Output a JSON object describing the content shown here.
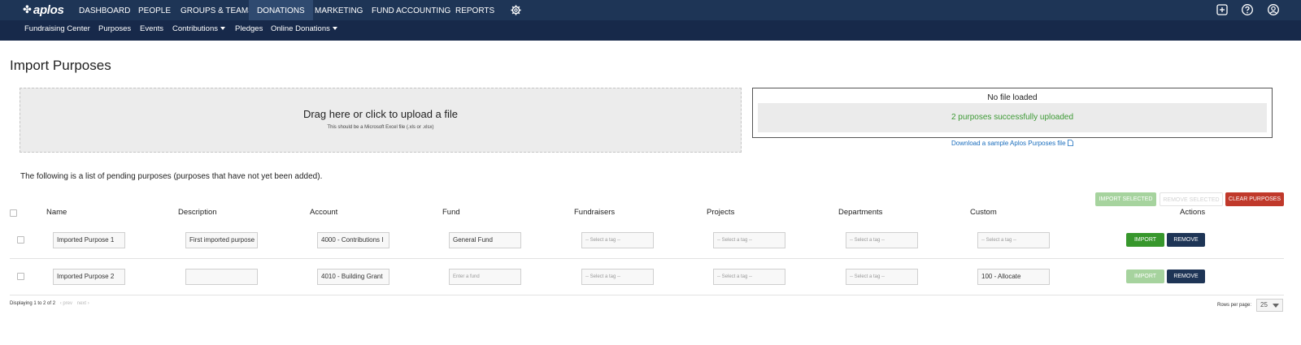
{
  "app": {
    "logo_text": "aplos"
  },
  "topnav": {
    "items": [
      "DASHBOARD",
      "PEOPLE",
      "GROUPS & TEAMS",
      "DONATIONS",
      "MARKETING",
      "FUND ACCOUNTING",
      "REPORTS"
    ],
    "active": "DONATIONS"
  },
  "subnav": {
    "items": [
      "Fundraising Center",
      "Purposes",
      "Events",
      "Contributions",
      "Pledges",
      "Online Donations"
    ]
  },
  "page": {
    "title": "Import Purposes"
  },
  "upload": {
    "title": "Drag here or click to upload a file",
    "subtitle": "This should be a Microsoft Excel file (.xls or .xlsx)"
  },
  "status": {
    "title": "No file loaded",
    "message": "2 purposes successfully uploaded",
    "message_color": "#3d9a35"
  },
  "sample_link": "Download a sample Aplos Purposes file",
  "pending_text": "The following is a list of pending purposes (purposes that have not yet been added).",
  "bulk_actions": {
    "import_selected": "IMPORT SELECTED",
    "remove_selected": "REMOVE SELECTED",
    "clear_purposes": "CLEAR PURPOSES"
  },
  "table": {
    "headers": [
      "Name",
      "Description",
      "Account",
      "Fund",
      "Fundraisers",
      "Projects",
      "Departments",
      "Custom",
      "Actions"
    ],
    "rows": [
      {
        "name": "Imported Purpose 1",
        "description": "First imported purpose",
        "account": "4000 - Contributions I",
        "fund": "General Fund",
        "fundraisers": "-- Select a tag --",
        "projects": "-- Select a tag --",
        "departments": "-- Select a tag --",
        "custom": "-- Select a tag --",
        "import_label": "IMPORT",
        "remove_label": "REMOVE"
      },
      {
        "name": "Imported Purpose 2",
        "description": "",
        "account": "4010 - Building Grant",
        "fund": "Enter a fund",
        "fundraisers": "-- Select a tag --",
        "projects": "-- Select a tag --",
        "departments": "-- Select a tag --",
        "custom": "100 - Allocate",
        "import_label": "IMPORT",
        "remove_label": "REMOVE"
      }
    ]
  },
  "pagination": {
    "displaying": "Displaying 1 to 2 of 2",
    "prev": "‹ prev",
    "next": "next ›",
    "rows_per_page_label": "Rows per page:",
    "rows_per_page": "25"
  },
  "colors": {
    "nav": "#1e3556",
    "subnav": "#17294a",
    "primary_green": "#37972c",
    "danger": "#c0392b",
    "link": "#1a6dbd"
  }
}
